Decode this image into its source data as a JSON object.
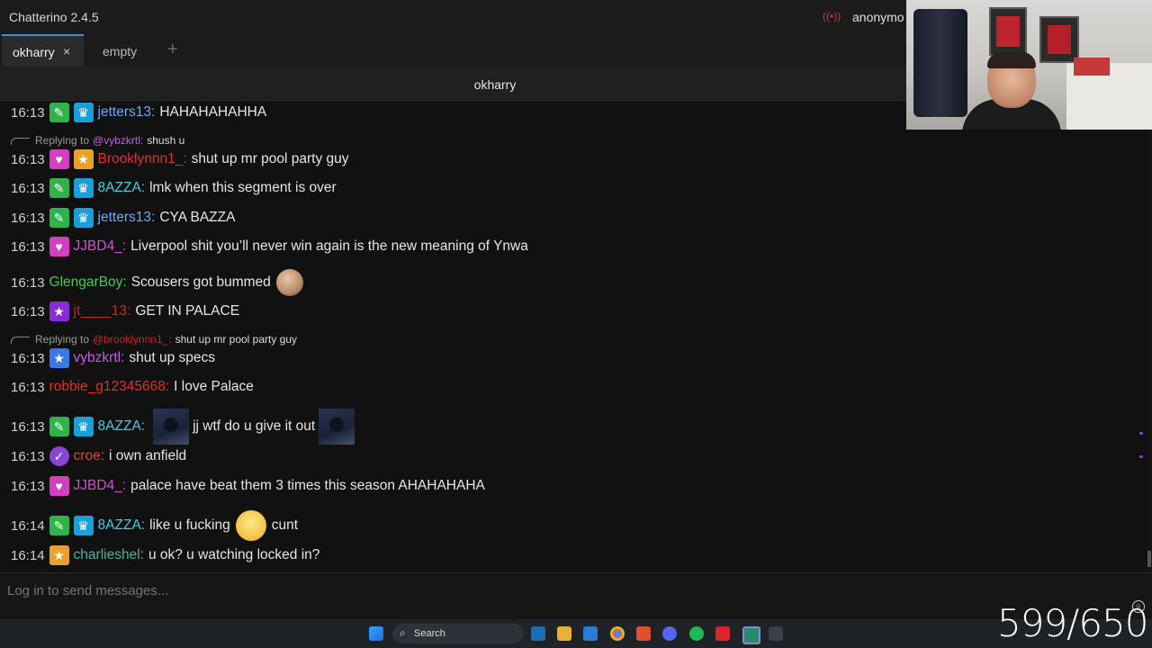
{
  "window": {
    "title": "Chatterino 2.4.5",
    "live_icon": "broadcast-icon",
    "user": "anonymo"
  },
  "tabs": [
    {
      "label": "okharry",
      "active": true,
      "close": "×"
    },
    {
      "label": "empty",
      "active": false
    }
  ],
  "add_tab": "+",
  "channel": {
    "name": "okharry"
  },
  "messages": [
    {
      "time": "16:13",
      "badges": [
        "sword",
        "crown"
      ],
      "user": "jetters13:",
      "user_color": "#6aa8f0",
      "text": "HAHAHAHAHHA"
    },
    {
      "reply": {
        "prefix": "Replying to",
        "target": "@vybzkrtl:",
        "target_color": "#c060e0",
        "text": "shush u"
      }
    },
    {
      "time": "16:13",
      "badges": [
        "heart",
        "star-orange"
      ],
      "user": "Brooklynnn1_:",
      "user_color": "#e0302a",
      "text": "shut up mr pool party guy"
    },
    {
      "time": "16:13",
      "badges": [
        "sword",
        "crown"
      ],
      "user": "8AZZA:",
      "user_color": "#3fd0e0",
      "text": "lmk when this segment is over"
    },
    {
      "time": "16:13",
      "badges": [
        "sword",
        "crown"
      ],
      "user": "jetters13:",
      "user_color": "#6aa8f0",
      "text": "CYA BAZZA"
    },
    {
      "time": "16:13",
      "badges": [
        "heart"
      ],
      "user": "JJBD4_:",
      "user_color": "#d050d0",
      "text": "Liverpool shit you’ll never win again is the new meaning of Ynwa"
    },
    {
      "time": "16:13",
      "badges": [],
      "user": "GlengarBoy:",
      "user_color": "#4ec84e",
      "text": "Scousers got bummed",
      "emote": "face-emote"
    },
    {
      "time": "16:13",
      "badges": [
        "star-purple"
      ],
      "user": "jt____13:",
      "user_color": "#c0282a",
      "text": "GET IN PALACE"
    },
    {
      "reply": {
        "prefix": "Replying to",
        "target": "@brooklynnn1_:",
        "target_color": "#c0282a",
        "text": "shut up mr pool party guy"
      }
    },
    {
      "time": "16:13",
      "badges": [
        "star-blue"
      ],
      "user": "vybzkrtl:",
      "user_color": "#c060e0",
      "text": "shut up specs"
    },
    {
      "time": "16:13",
      "badges": [],
      "user": "robbie_g12345668:",
      "user_color": "#e0302a",
      "text": "I love Palace"
    },
    {
      "time": "16:13",
      "badges": [
        "sword",
        "crown"
      ],
      "user": "8AZZA:",
      "user_color": "#3fd0e0",
      "text": "jj wtf do u give it out",
      "emote": "cat-emote"
    },
    {
      "time": "16:13",
      "badges": [
        "check"
      ],
      "user": "croe:",
      "user_color": "#e0442a",
      "text": "i own anfield"
    },
    {
      "time": "16:13",
      "badges": [
        "heart"
      ],
      "user": "JJBD4_:",
      "user_color": "#d050d0",
      "text": "palace have beat them 3 times this season AHAHAHAHA"
    },
    {
      "time": "16:14",
      "badges": [
        "sword",
        "crown"
      ],
      "user": "8AZZA:",
      "user_color": "#3fd0e0",
      "text": "like u fucking",
      "text2": "cunt",
      "emote": "eyes-emote"
    },
    {
      "time": "16:14",
      "badges": [
        "star-orange"
      ],
      "user": "charlieshel:",
      "user_color": "#4fb0a0",
      "text": "u ok? u watching locked in?"
    }
  ],
  "input": {
    "placeholder": "Log in to send messages..."
  },
  "taskbar": {
    "search_label": "Search"
  },
  "overlay": {
    "counter": "599/650"
  }
}
